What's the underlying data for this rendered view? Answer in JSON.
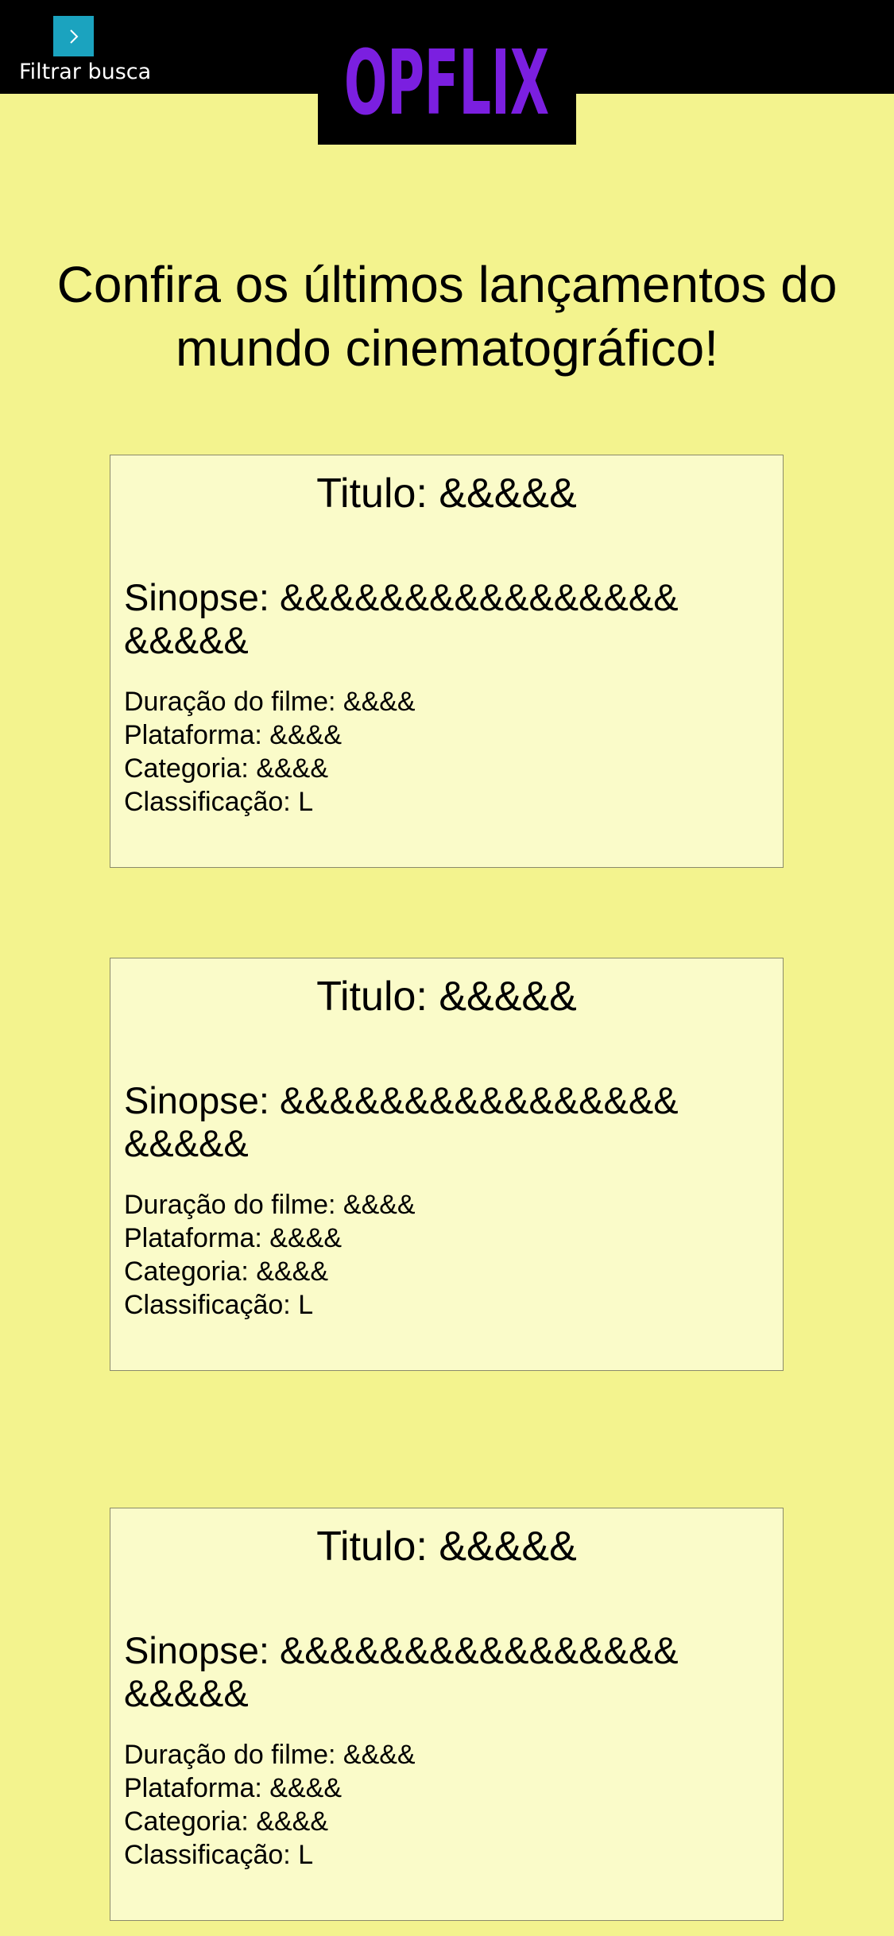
{
  "header": {
    "filter_label": "Filtrar busca",
    "filter_icon": "chevron-right-icon",
    "logo_text": "OPFLIX",
    "logo_color": "#7b1fe0",
    "filter_color": "#1ba3bf",
    "bar_color": "#000000"
  },
  "main": {
    "headline": "Confira os últimos lançamentos do mundo cinematográfico!"
  },
  "movies": [
    {
      "title": "Titulo: &&&&&",
      "synopsis": "Sinopse: &&&&&&&&&&&&&&&&&&&&&",
      "duration": "Duração do filme: &&&&",
      "platform": "Plataforma: &&&&",
      "category": "Categoria: &&&&",
      "rating": "Classificação: L"
    },
    {
      "title": "Titulo: &&&&&",
      "synopsis": "Sinopse: &&&&&&&&&&&&&&&&&&&&&",
      "duration": "Duração do filme: &&&&",
      "platform": "Plataforma: &&&&",
      "category": "Categoria: &&&&",
      "rating": "Classificação: L"
    },
    {
      "title": "Titulo: &&&&&",
      "synopsis": "Sinopse: &&&&&&&&&&&&&&&&&&&&&",
      "duration": "Duração do filme: &&&&",
      "platform": "Plataforma: &&&&",
      "category": "Categoria: &&&&",
      "rating": "Classificação: L"
    }
  ],
  "colors": {
    "background": "#f3f38e",
    "card": "#fafbc9"
  }
}
